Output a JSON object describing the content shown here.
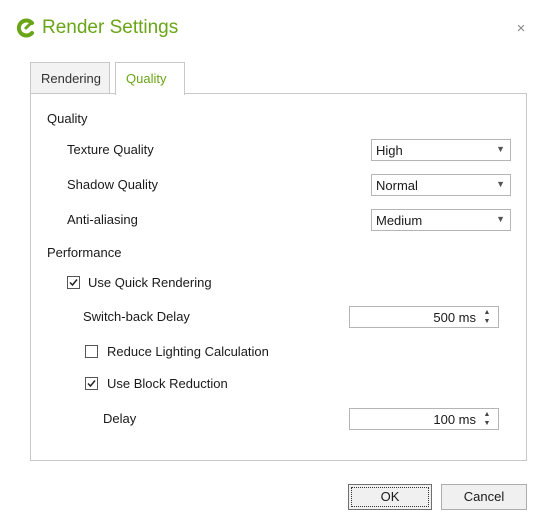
{
  "window": {
    "title": "Render Settings",
    "close_glyph": "×"
  },
  "colors": {
    "accent": "#6aa517"
  },
  "tabs": [
    {
      "label": "Rendering",
      "active": false
    },
    {
      "label": "Quality",
      "active": true
    }
  ],
  "quality_section": {
    "heading": "Quality",
    "texture": {
      "label": "Texture Quality",
      "value": "High"
    },
    "shadow": {
      "label": "Shadow Quality",
      "value": "Normal"
    },
    "antialias": {
      "label": "Anti-aliasing",
      "value": "Medium"
    }
  },
  "performance_section": {
    "heading": "Performance",
    "quick_rendering": {
      "label": "Use Quick Rendering",
      "checked": true
    },
    "switch_back": {
      "label": "Switch-back Delay",
      "value": "500 ms"
    },
    "reduce_lighting": {
      "label": "Reduce Lighting Calculation",
      "checked": false
    },
    "block_reduction": {
      "label": "Use Block Reduction",
      "checked": true
    },
    "delay": {
      "label": "Delay",
      "value": "100 ms"
    }
  },
  "buttons": {
    "ok": "OK",
    "cancel": "Cancel"
  },
  "icons": {
    "logo": "app-logo-icon",
    "dropdown": "chevron-down-icon",
    "spin": "spinner-arrows-icon",
    "check": "checkmark-icon"
  }
}
